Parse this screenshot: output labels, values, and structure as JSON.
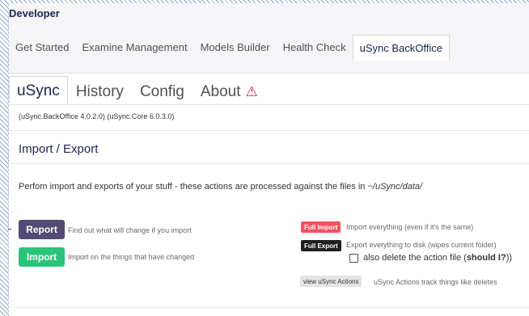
{
  "header": {
    "title": "Developer"
  },
  "tabs": [
    {
      "label": "Get Started"
    },
    {
      "label": "Examine Management"
    },
    {
      "label": "Models Builder"
    },
    {
      "label": "Health Check"
    },
    {
      "label": "uSync BackOffice",
      "active": true
    }
  ],
  "subtabs": [
    {
      "label": "uSync",
      "active": true
    },
    {
      "label": "History"
    },
    {
      "label": "Config"
    },
    {
      "label": "About",
      "icon": "warning-icon"
    }
  ],
  "version": "(uSync.BackOffice 4.0.2.0) (uSync.Core 6.0.3.0)",
  "section": {
    "title": "Import / Export"
  },
  "description": {
    "text": "Perfom import and exports of your stuff - these actions are processed against the files in ",
    "path": "~/uSync/data/"
  },
  "actions": {
    "report": {
      "label": "Report",
      "hint": "Find out what will change if you import"
    },
    "import": {
      "label": "Import",
      "hint": "Import on the things that have changed"
    },
    "full_import": {
      "label": "Full Import",
      "hint": "Import everything (even if it's the same)"
    },
    "full_export": {
      "label": "Full Export",
      "hint": "Export everything to disk (wipes current folder)"
    },
    "delete_option": {
      "text": "also delete the action file (",
      "link": "should I?",
      "suffix": "))",
      "checked": false
    },
    "view_actions": {
      "label": "view uSync Actions",
      "hint": "uSync Actions track things like deletes"
    }
  },
  "colors": {
    "report": "#544b74",
    "import": "#2bc37c",
    "full_import": "#f0535e",
    "full_export": "#1f1f22",
    "warning": "#d42054"
  }
}
